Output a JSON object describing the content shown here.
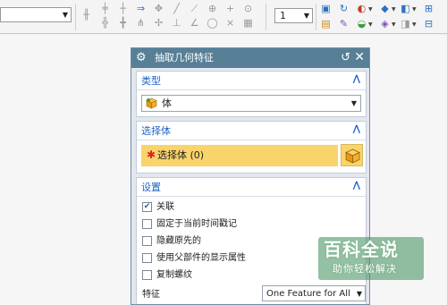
{
  "toolbar": {
    "snap_combo_value": "",
    "layer_value": "1",
    "icons": [
      "snap-icon",
      "point-icon",
      "arrow-icon",
      "move-icon",
      "line-icon",
      "circle-icon",
      "plus-icon",
      "grid-icon",
      "rotate-icon",
      "view-icon",
      "render-icon",
      "cube-icon",
      "brush-icon",
      "color-icon",
      "section-icon"
    ]
  },
  "dialog": {
    "title": "抽取几何特征",
    "sections": {
      "type": {
        "heading": "类型",
        "selected": "体"
      },
      "select_body": {
        "heading": "选择体",
        "prompt": "选择体 (0)"
      },
      "settings": {
        "heading": "设置",
        "options": [
          {
            "label": "关联",
            "checked": true
          },
          {
            "label": "固定于当前时间戳记",
            "checked": false
          },
          {
            "label": "隐藏原先的",
            "checked": false
          },
          {
            "label": "使用父部件的显示属性",
            "checked": false
          },
          {
            "label": "复制螺纹",
            "checked": false
          }
        ],
        "feature_label": "特征",
        "feature_value": "One Feature for All B"
      }
    }
  },
  "watermark": {
    "logo": "百科全说",
    "tagline": "助你轻松解决"
  },
  "colors": {
    "title_bar": "#577f96",
    "section_heading": "#1f63c6",
    "selection_highlight": "#f9d46b"
  }
}
